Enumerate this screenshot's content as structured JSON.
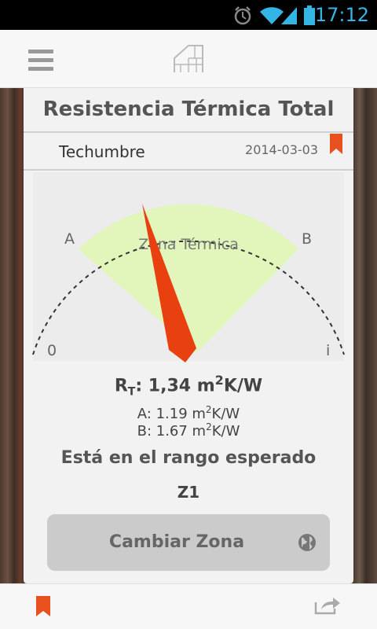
{
  "status_bar": {
    "time": "17:12"
  },
  "app_bar": {
    "logo": "building-logo"
  },
  "card": {
    "title": "Resistencia Térmica Total",
    "item_name": "Techumbre",
    "date": "2014-03-03"
  },
  "gauge": {
    "zone_label": "Zona Térmica",
    "label_a": "A",
    "label_b": "B",
    "label_min": "0",
    "label_max": "i",
    "zone_color": "#e2f5bb",
    "needle_color": "#e8400e"
  },
  "result": {
    "rt_prefix": "R",
    "rt_sub": "T",
    "rt_value": ": 1,34 m",
    "rt_exp": "2",
    "rt_unit": "K/W",
    "a_prefix": "A: 1.19 m",
    "a_exp": "2",
    "a_unit": "K/W",
    "b_prefix": "B: 1.67 m",
    "b_exp": "2",
    "b_unit": "K/W",
    "status": "Está en el rango esperado",
    "zone": "Z1"
  },
  "button": {
    "label": "Cambiar Zona"
  },
  "colors": {
    "accent": "#e8501e",
    "status_text": "#33b5e5"
  }
}
